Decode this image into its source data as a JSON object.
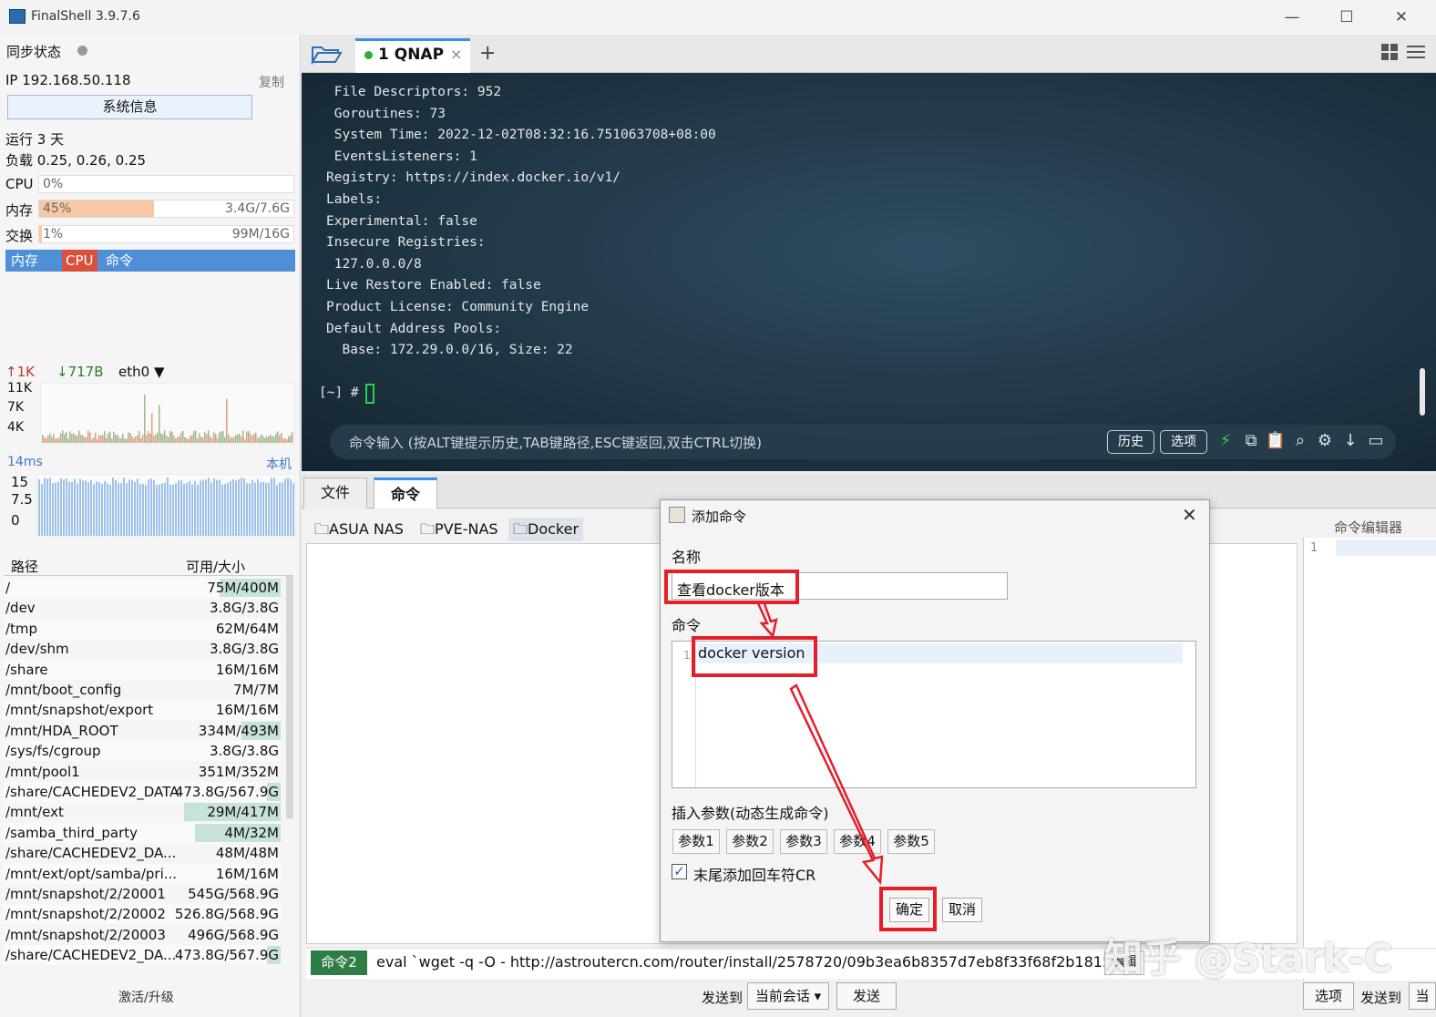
{
  "window": {
    "title": "FinalShell 3.9.7.6",
    "minimize": "—",
    "maximize": "☐",
    "close": "✕"
  },
  "sidebar": {
    "sync_status": "同步状态",
    "ip": "IP 192.168.50.118",
    "copy": "复制",
    "sysinfo_button": "系统信息",
    "uptime": "运行 3 天",
    "load": "负载 0.25, 0.26, 0.25",
    "cpu": {
      "label": "CPU",
      "value": "0%",
      "fraction": 0.0
    },
    "mem": {
      "label": "内存",
      "value": "45%",
      "size": "3.4G/7.6G",
      "fraction": 0.45
    },
    "swap": {
      "label": "交换",
      "value": "1%",
      "size": "99M/16G",
      "fraction": 0.01
    },
    "proc_tabs": [
      "内存",
      "CPU",
      "命令"
    ],
    "net": {
      "up": "1K",
      "down": "717B",
      "iface": "eth0",
      "ticks": [
        "11K",
        "7K",
        "4K"
      ]
    },
    "latency": {
      "value": "14ms",
      "host": "本机",
      "ticks": [
        "15",
        "7.5",
        "0"
      ]
    },
    "disk_header": {
      "path": "路径",
      "size": "可用/大小"
    },
    "disks": [
      {
        "path": "/",
        "size": "75M/400M",
        "used": 0.22
      },
      {
        "path": "/dev",
        "size": "3.8G/3.8G",
        "used": 0.0
      },
      {
        "path": "/tmp",
        "size": "62M/64M",
        "used": 0.0
      },
      {
        "path": "/dev/shm",
        "size": "3.8G/3.8G",
        "used": 0.0
      },
      {
        "path": "/share",
        "size": "16M/16M",
        "used": 0.0
      },
      {
        "path": "/mnt/boot_config",
        "size": "7M/7M",
        "used": 0.0
      },
      {
        "path": "/mnt/snapshot/export",
        "size": "16M/16M",
        "used": 0.0
      },
      {
        "path": "/mnt/HDA_ROOT",
        "size": "334M/493M",
        "used": 0.14
      },
      {
        "path": "/sys/fs/cgroup",
        "size": "3.8G/3.8G",
        "used": 0.0
      },
      {
        "path": "/mnt/pool1",
        "size": "351M/352M",
        "used": 0.0
      },
      {
        "path": "/share/CACHEDEV2_DATA",
        "size": "473.8G/567.9G",
        "used": 0.05
      },
      {
        "path": "/mnt/ext",
        "size": "29M/417M",
        "used": 0.35
      },
      {
        "path": "/samba_third_party",
        "size": "4M/32M",
        "used": 0.31
      },
      {
        "path": "/share/CACHEDEV2_DA...",
        "size": "48M/48M",
        "used": 0.0
      },
      {
        "path": "/mnt/ext/opt/samba/pri...",
        "size": "16M/16M",
        "used": 0.0
      },
      {
        "path": "/mnt/snapshot/2/20001",
        "size": "545G/568.9G",
        "used": 0.0
      },
      {
        "path": "/mnt/snapshot/2/20002",
        "size": "526.8G/568.9G",
        "used": 0.0
      },
      {
        "path": "/mnt/snapshot/2/20003",
        "size": "496G/568.9G",
        "used": 0.0
      },
      {
        "path": "/share/CACHEDEV2_DA...",
        "size": "473.8G/567.9G",
        "used": 0.05
      }
    ],
    "activate": "激活/升级"
  },
  "tabs": {
    "session": "1 QNAP",
    "close": "×",
    "add": "+"
  },
  "terminal": {
    "lines": [
      " File Descriptors: 952",
      " Goroutines: 73",
      " System Time: 2022-12-02T08:32:16.751063708+08:00",
      " EventsListeners: 1",
      "Registry: https://index.docker.io/v1/",
      "Labels:",
      "Experimental: false",
      "Insecure Registries:",
      " 127.0.0.0/8",
      "Live Restore Enabled: false",
      "Product License: Community Engine",
      "Default Address Pools:",
      "  Base: 172.29.0.0/16, Size: 22"
    ],
    "prompt": "[~] #",
    "input_placeholder": "命令输入 (按ALT键提示历史,TAB键路径,ESC键返回,双击CTRL切换)",
    "history_button": "历史",
    "options_button": "选项"
  },
  "lower": {
    "tabs": [
      "文件",
      "命令"
    ],
    "folders": [
      "ASUA NAS",
      "PVE-NAS",
      "Docker"
    ],
    "editor_label": "命令编辑器",
    "editor_line": "1",
    "cmd_badge": "命令2",
    "cmd_text": "eval `wget -q -O - http://astroutercn.com/router/install/2578720/09b3ea6b8357d7eb8f33f68f2b1815ca`",
    "cmd_edit": "编辑",
    "send_to": "发送到",
    "current_session": "当前会话",
    "send": "发送",
    "options": "选项",
    "send_to_2": "发送到",
    "cut": "当"
  },
  "dialog": {
    "title": "添加命令",
    "close": "✕",
    "name_label": "名称",
    "name_value": "查看docker版本",
    "command_label": "命令",
    "line_number": "1",
    "command_value": "docker version",
    "params_label": "插入参数(动态生成命令)",
    "params": [
      "参数1",
      "参数2",
      "参数3",
      "参数4",
      "参数5"
    ],
    "cr_label": "末尾添加回车符CR",
    "cr_checked": true,
    "ok": "确定",
    "cancel": "取消"
  },
  "watermark": "知乎 @Stark-C",
  "colors": {
    "accent": "#3a8ee6",
    "annotation_red": "#e41f2a",
    "terminal_green": "#2fd04a",
    "mem_fill": "#f7c8a3"
  }
}
